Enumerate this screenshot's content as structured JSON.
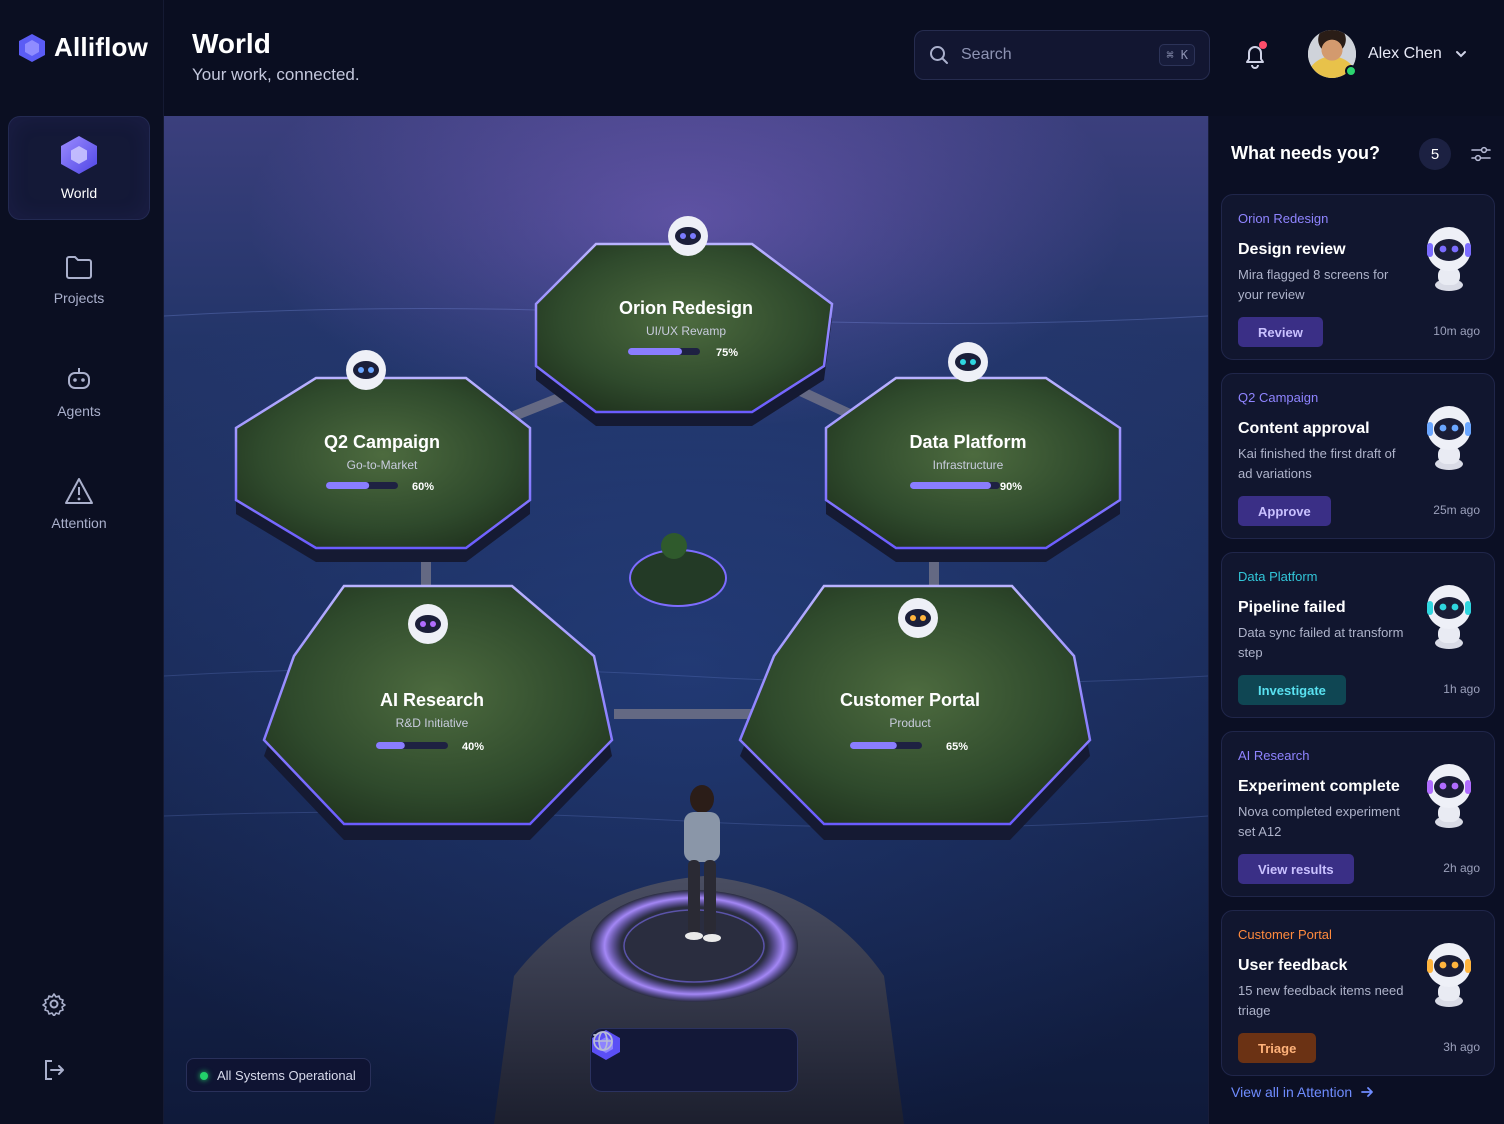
{
  "app": {
    "name": "Alliflow"
  },
  "sidebar": {
    "items": [
      {
        "label": "World",
        "icon": "hexagon-icon",
        "active": true
      },
      {
        "label": "Projects",
        "icon": "folder-icon"
      },
      {
        "label": "Agents",
        "icon": "robot-icon"
      },
      {
        "label": "Attention",
        "icon": "warning-triangle-icon"
      }
    ],
    "bottom": [
      {
        "icon": "settings-gear-icon"
      },
      {
        "icon": "logout-icon"
      }
    ]
  },
  "header": {
    "title": "World",
    "subtitle": "Your work, connected.",
    "search": {
      "placeholder": "Search",
      "shortcut": "⌘ K"
    },
    "notifications": {
      "has_unread": true
    },
    "user": {
      "name": "Alex Chen",
      "status": "online"
    }
  },
  "world": {
    "islands": [
      {
        "name": "Orion Redesign",
        "subtitle": "UI/UX Revamp",
        "progress": 75,
        "progress_label": "75%"
      },
      {
        "name": "Q2 Campaign",
        "subtitle": "Go-to-Market",
        "progress": 60,
        "progress_label": "60%"
      },
      {
        "name": "Data Platform",
        "subtitle": "Infrastructure",
        "progress": 90,
        "progress_label": "90%"
      },
      {
        "name": "AI Research",
        "subtitle": "R&D Initiative",
        "progress": 40,
        "progress_label": "40%"
      },
      {
        "name": "Customer Portal",
        "subtitle": "Product",
        "progress": 65,
        "progress_label": "65%"
      }
    ],
    "status": "All Systems Operational",
    "toolbar": [
      "sliders-icon",
      "hexagon-icon",
      "globe-icon"
    ]
  },
  "attention": {
    "title": "What needs you?",
    "count": "5",
    "cards": [
      {
        "project": "Orion Redesign",
        "project_color": "#8f84ff",
        "title": "Design review",
        "description": "Mira flagged 8 screens for your review",
        "action": "Review",
        "action_bg": "#3a2f86",
        "action_color": "#c9c1ff",
        "time": "10m ago",
        "bot_color": "#7b6cff"
      },
      {
        "project": "Q2 Campaign",
        "project_color": "#8f84ff",
        "title": "Content approval",
        "description": "Kai finished the first draft of ad variations",
        "action": "Approve",
        "action_bg": "#3a2f86",
        "action_color": "#c9c1ff",
        "time": "25m ago",
        "bot_color": "#6aa6ff"
      },
      {
        "project": "Data Platform",
        "project_color": "#32c6d9",
        "title": "Pipeline failed",
        "description": "Data sync failed at transform step",
        "action": "Investigate",
        "action_bg": "#0f4653",
        "action_color": "#59e1f0",
        "time": "1h ago",
        "bot_color": "#2fd6df"
      },
      {
        "project": "AI Research",
        "project_color": "#8f84ff",
        "title": "Experiment complete",
        "description": "Nova completed experiment set A12",
        "action": "View results",
        "action_bg": "#3a2f86",
        "action_color": "#c9c1ff",
        "time": "2h ago",
        "bot_color": "#b06cff"
      },
      {
        "project": "Customer Portal",
        "project_color": "#ff8a3d",
        "title": "User feedback",
        "description": "15 new feedback items need triage",
        "action": "Triage",
        "action_bg": "#6b3214",
        "action_color": "#ffb27a",
        "time": "3h ago",
        "bot_color": "#ffb43d"
      }
    ],
    "view_all": "View all in Attention"
  },
  "colors": {
    "accent": "#6d5dfc",
    "progress": "#8a7dff",
    "background": "#0a0d1f"
  }
}
